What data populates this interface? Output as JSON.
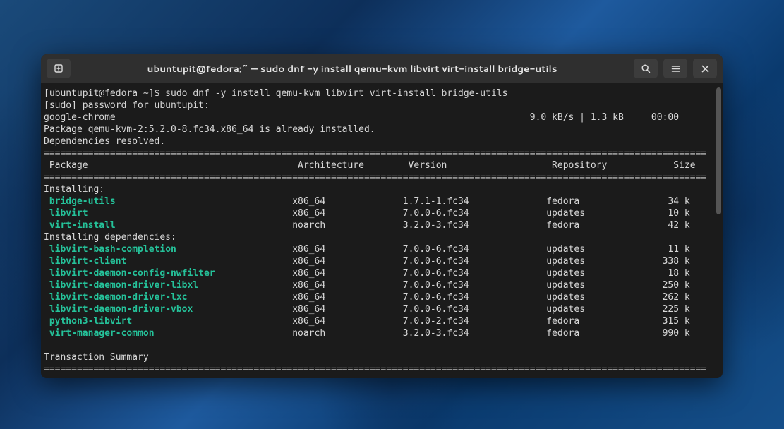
{
  "titlebar": {
    "title": "ubuntupit@fedora:~ — sudo dnf -y install qemu-kvm libvirt virt-install bridge-utils"
  },
  "prompt": {
    "user_host": "[ubuntupit@fedora ~]$ ",
    "command": "sudo dnf -y install qemu-kvm libvirt virt-install bridge-utils"
  },
  "lines": {
    "sudo_prompt": "[sudo] password for ubuntupit:",
    "repo_name": "google-chrome",
    "repo_speed": "9.0 kB/s |",
    "repo_size": "1.3 kB",
    "repo_time": "00:00",
    "already_installed": "Package qemu-kvm-2:5.2.0-8.fc34.x86_64 is already installed.",
    "deps_resolved": "Dependencies resolved."
  },
  "headers": {
    "package": "Package",
    "arch": "Architecture",
    "version": "Version",
    "repo": "Repository",
    "size": "Size"
  },
  "sections": {
    "installing": "Installing:",
    "installing_deps": "Installing dependencies:",
    "txn_summary": "Transaction Summary"
  },
  "packages": {
    "installing": [
      {
        "name": "bridge-utils",
        "arch": "x86_64",
        "version": "1.7.1-1.fc34",
        "repo": "fedora",
        "size": "34 k"
      },
      {
        "name": "libvirt",
        "arch": "x86_64",
        "version": "7.0.0-6.fc34",
        "repo": "updates",
        "size": "10 k"
      },
      {
        "name": "virt-install",
        "arch": "noarch",
        "version": "3.2.0-3.fc34",
        "repo": "fedora",
        "size": "42 k"
      }
    ],
    "deps": [
      {
        "name": "libvirt-bash-completion",
        "arch": "x86_64",
        "version": "7.0.0-6.fc34",
        "repo": "updates",
        "size": "11 k"
      },
      {
        "name": "libvirt-client",
        "arch": "x86_64",
        "version": "7.0.0-6.fc34",
        "repo": "updates",
        "size": "338 k"
      },
      {
        "name": "libvirt-daemon-config-nwfilter",
        "arch": "x86_64",
        "version": "7.0.0-6.fc34",
        "repo": "updates",
        "size": "18 k"
      },
      {
        "name": "libvirt-daemon-driver-libxl",
        "arch": "x86_64",
        "version": "7.0.0-6.fc34",
        "repo": "updates",
        "size": "250 k"
      },
      {
        "name": "libvirt-daemon-driver-lxc",
        "arch": "x86_64",
        "version": "7.0.0-6.fc34",
        "repo": "updates",
        "size": "262 k"
      },
      {
        "name": "libvirt-daemon-driver-vbox",
        "arch": "x86_64",
        "version": "7.0.0-6.fc34",
        "repo": "updates",
        "size": "225 k"
      },
      {
        "name": "python3-libvirt",
        "arch": "x86_64",
        "version": "7.0.0-2.fc34",
        "repo": "fedora",
        "size": "315 k"
      },
      {
        "name": "virt-manager-common",
        "arch": "noarch",
        "version": "3.2.0-3.fc34",
        "repo": "fedora",
        "size": "990 k"
      }
    ]
  }
}
